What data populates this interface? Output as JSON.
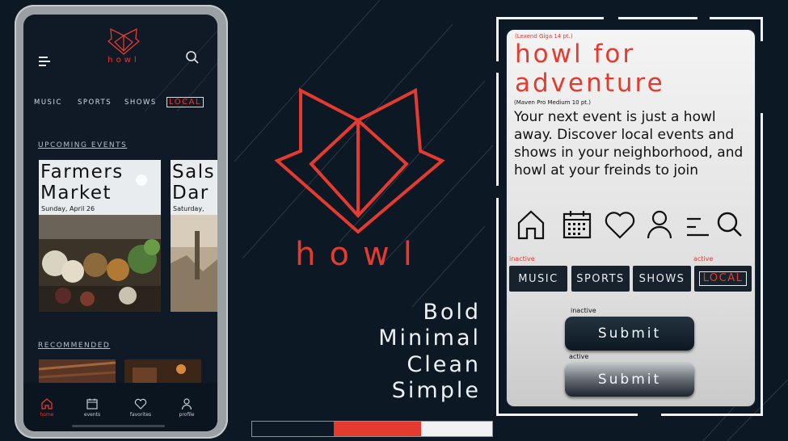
{
  "colors": {
    "background": "#0c1823",
    "accent": "#e53a2f",
    "card": "#ececec",
    "dark_chip": "#17222c"
  },
  "phone": {
    "brand": "howl",
    "tabs": [
      "MUSIC",
      "SPORTS",
      "SHOWS",
      "LOCAL"
    ],
    "upcoming_title": "UPCOMING EVENTS",
    "events": [
      {
        "title": "Farmers\nMarket",
        "date": "Sunday, April 26"
      },
      {
        "title": "Sals\nDar",
        "date": "Saturday,"
      }
    ],
    "recommended_title": "RECOMMENDED",
    "nav": [
      {
        "label": "home",
        "icon": "home-icon",
        "active": true
      },
      {
        "label": "events",
        "icon": "calendar-icon",
        "active": false
      },
      {
        "label": "favorites",
        "icon": "heart-icon",
        "active": false
      },
      {
        "label": "profile",
        "icon": "profile-icon",
        "active": false
      }
    ]
  },
  "center": {
    "logo_word": "howl",
    "tagline": [
      "Bold",
      "Minimal",
      "Clean",
      "Simple"
    ],
    "palette_strip": [
      "#0c1823",
      "#e53a2f",
      "#f2f2f2"
    ]
  },
  "style_card": {
    "heading_spec": "(Lexend Giga 14 pt.)",
    "headline": "howl for adventure",
    "body_spec": "(Maven Pro Medium 10 pt.)",
    "body": "Your next event is just a howl away. Discover local events and shows in your neighborhood, and howl at your freinds to join",
    "icons": [
      "home-icon",
      "calendar-icon",
      "heart-icon",
      "profile-icon",
      "menu-icon",
      "search-icon"
    ],
    "chip_inactive_label": "inactive",
    "chip_active_label": "active",
    "chips": [
      "MUSIC",
      "SPORTS",
      "SHOWS",
      "LOCAL"
    ],
    "button_inactive_label": "inactive",
    "button_active_label": "active",
    "button_text": "Submit"
  }
}
